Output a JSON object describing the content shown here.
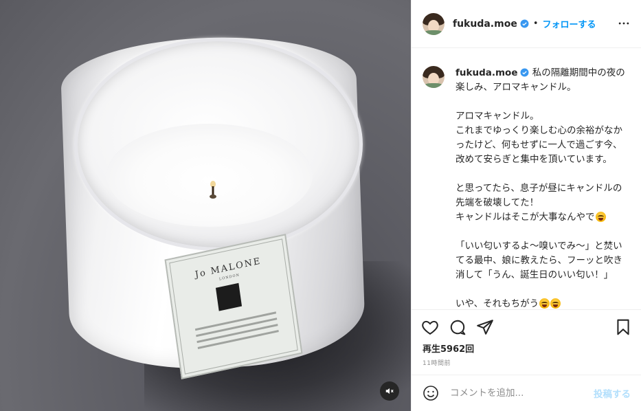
{
  "media": {
    "label_brand": "Jo MALONE",
    "label_sub": "LONDON"
  },
  "header": {
    "username": "fukuda.moe",
    "separator": "•",
    "follow_label": "フォローする"
  },
  "caption": {
    "username": "fukuda.moe",
    "line1": " 私の隔離期間中の夜の楽しみ、アロマキャンドル。",
    "para1": "アロマキャンドル。\nこれまでゆっくり楽しむ心の余裕がなかったけど、何もせずに一人で過ごす今、改めて安らぎと集中を頂いています。",
    "para2a": "と思ってたら、息子が昼にキャンドルの先端を破壊してた！\nキャンドルはそこが大事なんやで",
    "para3": "「いい匂いするよ～嗅いでみ～」と焚いてる最中、娘に教えたら、フーッと吹き消して「うん、誕生日のいい匂い！」",
    "para4": "いや、それもちがう"
  },
  "stats": {
    "views": "再生5962回",
    "timestamp": "11時間前"
  },
  "comment": {
    "placeholder": "コメントを追加...",
    "post_label": "投稿する"
  },
  "colors": {
    "accent": "#0095f6",
    "post_disabled": "#b2dffc"
  }
}
